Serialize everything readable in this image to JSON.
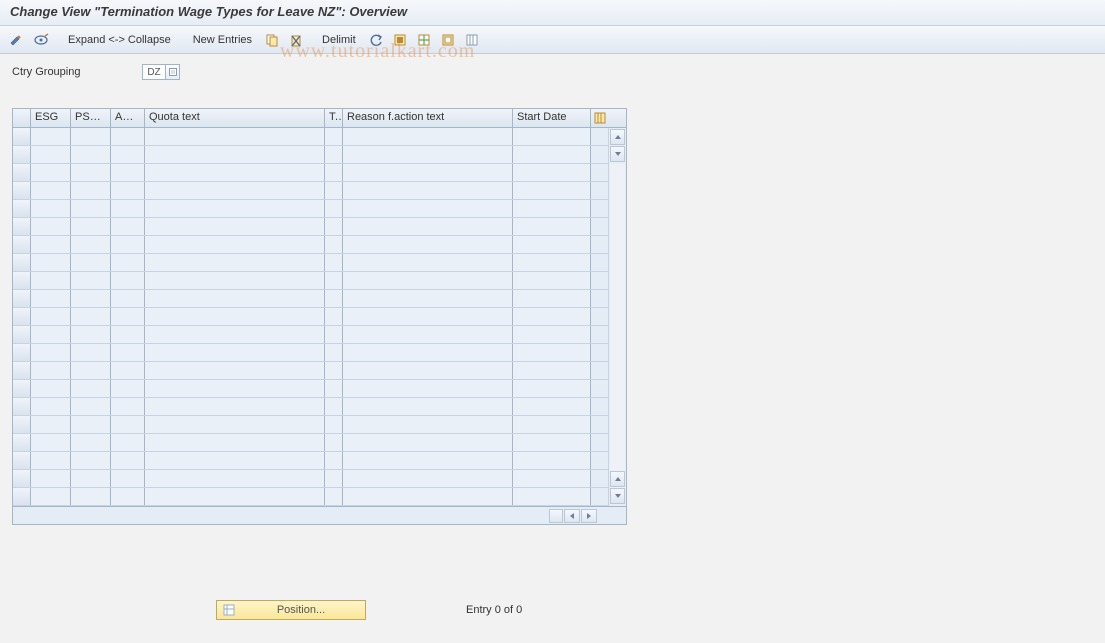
{
  "title": "Change View \"Termination Wage Types for Leave NZ\": Overview",
  "toolbar": {
    "expand_collapse": "Expand <-> Collapse",
    "new_entries": "New Entries",
    "delimit": "Delimit"
  },
  "field": {
    "label": "Ctry Grouping",
    "value": "DZ"
  },
  "table": {
    "columns": {
      "esg": "ESG",
      "psg": "PSG...",
      "aq": "AQ...",
      "quota": "Quota text",
      "t": "T..",
      "reason": "Reason f.action text",
      "start": "Start Date"
    },
    "rows": [
      {},
      {},
      {},
      {},
      {},
      {},
      {},
      {},
      {},
      {},
      {},
      {},
      {},
      {},
      {},
      {},
      {},
      {},
      {},
      {},
      {}
    ]
  },
  "footer": {
    "position": "Position...",
    "entry": "Entry 0 of 0"
  },
  "watermark": "www.tutorialkart.com"
}
